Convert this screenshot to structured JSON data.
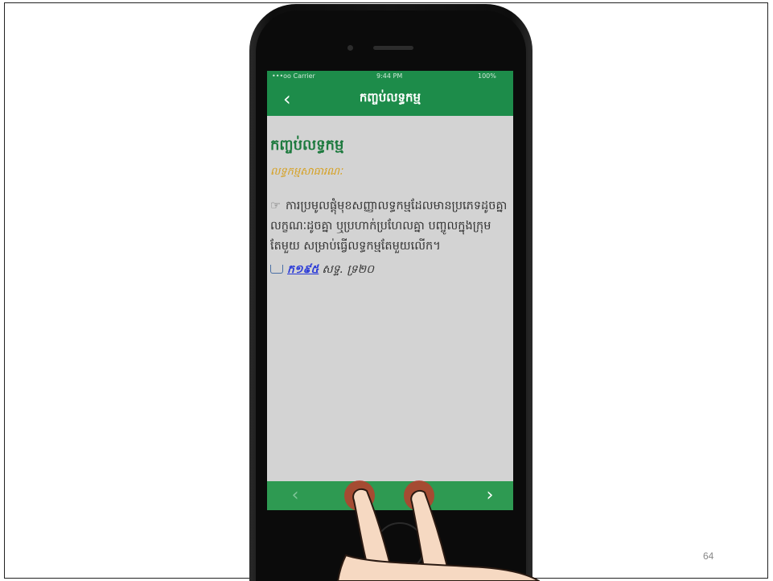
{
  "slide": {
    "page_number": "64"
  },
  "status_bar": {
    "carrier": "•••oo Carrier",
    "time": "9:44 PM",
    "battery": "100%"
  },
  "nav": {
    "back_glyph": "‹",
    "title": "កញ្ចប់លទ្ធកម្ម"
  },
  "entry": {
    "title": "កញ្ចប់លទ្ធកម្ម",
    "subtitle": "លទ្ធកម្មសាធារណៈ",
    "definition_icon": "☞",
    "definition": "ការប្រមូលផ្តុំមុខសញ្ញាលទ្ធកម្មដែលមានប្រភេទដូចគ្នា លក្ខណៈដូចគ្នា ឬប្រហាក់ប្រហែលគ្នា បញ្ចូលក្នុងក្រុមតែមួយ សម្រាប់ធ្វើលទ្ធកម្មតែមួយលើក។",
    "reference_link": "ក១៩៥",
    "reference_text": "សទ្ទ. ទ្រ២០"
  },
  "bottom_bar": {
    "prev_glyph": "‹",
    "next_glyph": "›"
  },
  "icons": {
    "back": "chevron-left-icon",
    "prev": "chevron-left-icon",
    "next": "chevron-right-icon",
    "reference": "book-icon",
    "definition": "pointing-hand-icon"
  },
  "colors": {
    "brand_green": "#1d8c4a",
    "title_green": "#1d7a3e",
    "subtitle_gold": "#d6a020",
    "link_blue": "#2b3bd8",
    "touch_red": "#c0392b"
  }
}
